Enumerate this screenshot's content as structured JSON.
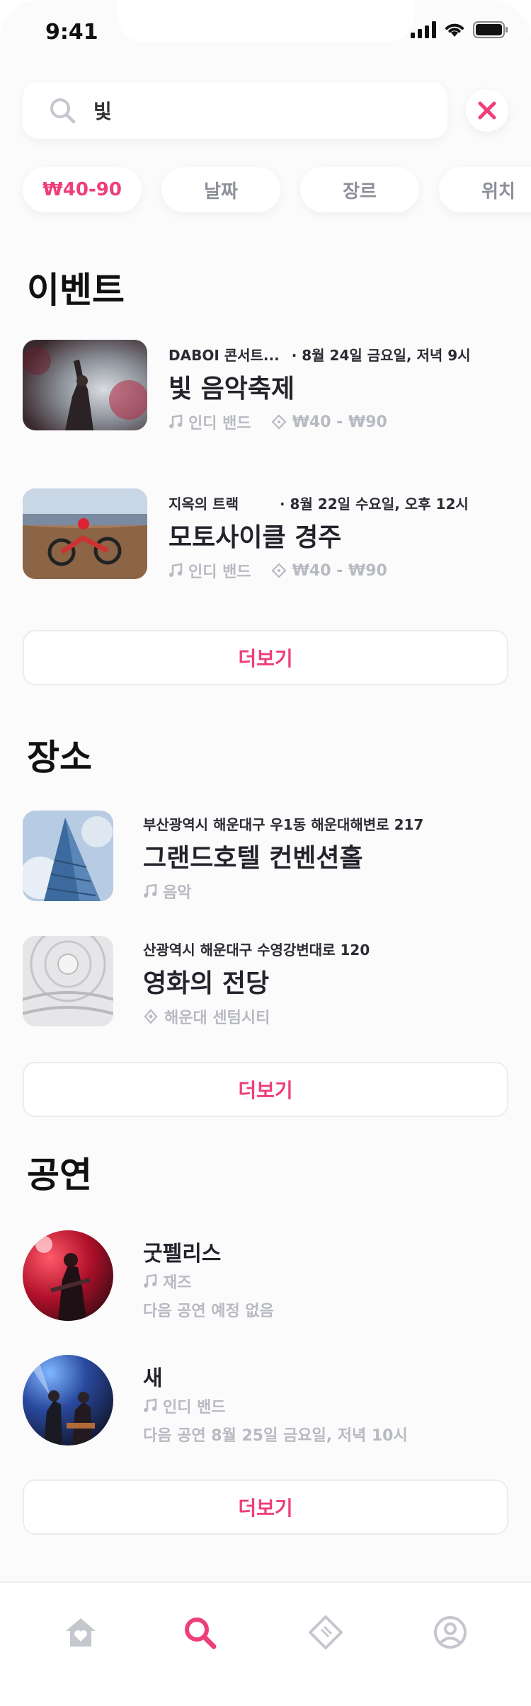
{
  "status_bar": {
    "time": "9:41"
  },
  "search": {
    "value": "빛",
    "placeholder": ""
  },
  "filters": [
    {
      "label": "₩40-90",
      "active": true
    },
    {
      "label": "날짜",
      "active": false
    },
    {
      "label": "장르",
      "active": false
    },
    {
      "label": "위치",
      "active": false
    }
  ],
  "events": {
    "title": "이벤트",
    "items": [
      {
        "venue": "DABOI 콘서트...",
        "date": "· 8월 24일 금요일, 저녁 9시",
        "name": "빛 음악축제",
        "genre": "인디 밴드",
        "price": "₩40 - ₩90"
      },
      {
        "venue": "지옥의 트랙",
        "date": "· 8월 22일 수요일, 오후 12시",
        "name": "모토사이클 경주",
        "genre": "인디 밴드",
        "price": "₩40 - ₩90"
      }
    ],
    "more_label": "더보기"
  },
  "venues": {
    "title": "장소",
    "items": [
      {
        "address": "부산광역시 해운대구 우1동 해운대해변로 217",
        "name": "그랜드호텔 컨벤션홀",
        "tag": "음악"
      },
      {
        "address": "산광역시 해운대구 수영강변대로 120",
        "name": "영화의 전당",
        "tag": "해운대 센텀시티"
      }
    ],
    "more_label": "더보기"
  },
  "performers": {
    "title": "공연",
    "items": [
      {
        "name": "굿펠리스",
        "genre": "재즈",
        "next": "다음 공연 예정 없음"
      },
      {
        "name": "새",
        "genre": "인디 밴드",
        "next": "다음 공연 8월 25일 금요일, 저녁 10시"
      }
    ],
    "more_label": "더보기"
  },
  "tabbar": {
    "items": [
      {
        "icon": "home-heart-icon",
        "active": false
      },
      {
        "icon": "search-icon",
        "active": true
      },
      {
        "icon": "ticket-icon",
        "active": false
      },
      {
        "icon": "profile-icon",
        "active": false
      }
    ]
  },
  "colors": {
    "accent": "#ee3f78",
    "muted": "#b8bac2",
    "text": "#23232b"
  }
}
